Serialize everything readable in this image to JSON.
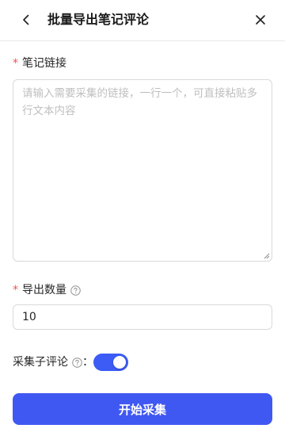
{
  "header": {
    "title": "批量导出笔记评论",
    "back_icon": "chevron-left-icon",
    "close_icon": "close-icon"
  },
  "form": {
    "required_mark": "*",
    "links_label": "笔记链接",
    "links_placeholder": "请输入需要采集的链接，一行一个，可直接粘贴多行文本内容",
    "links_value": "",
    "count_label": "导出数量",
    "count_value": "10",
    "count_help_icon": "question-circle-icon",
    "sub_comments_label": "采集子评论",
    "sub_comments_help_icon": "question-circle-icon",
    "sub_comments_colon": "：",
    "sub_comments_enabled": true,
    "submit_label": "开始采集"
  },
  "colors": {
    "primary": "#4058f2",
    "required": "#ff4d4f",
    "border": "#d9d9d9",
    "placeholder": "#bfbfbf"
  }
}
